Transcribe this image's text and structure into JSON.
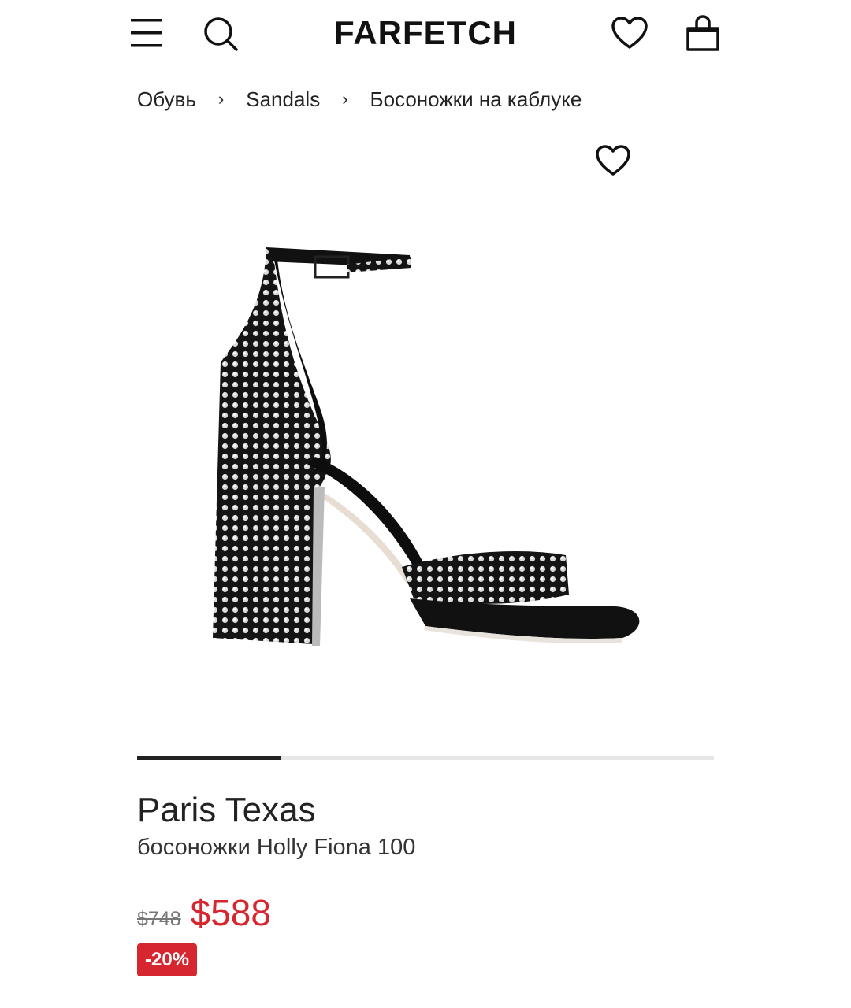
{
  "header": {
    "logo": "FARFETCH",
    "icons": [
      "menu-icon",
      "search-icon",
      "heart-icon",
      "shopping-bag-icon"
    ]
  },
  "breadcrumb": {
    "items": [
      "Обувь",
      "Sandals",
      "Босоножки на каблуке"
    ],
    "separator": "›"
  },
  "gallery": {
    "image": "black studded ankle-strap block-heel sandal",
    "favorite_icon": "heart-icon",
    "progress": 0.25
  },
  "product": {
    "brand": "Paris Texas",
    "name": "босоножки Holly Fiona 100",
    "old_price": "$748",
    "price": "$588",
    "discount": "-20%"
  },
  "colors": {
    "accent": "#d6262f",
    "text": "#222222",
    "progress_track": "#e6e6e6"
  }
}
